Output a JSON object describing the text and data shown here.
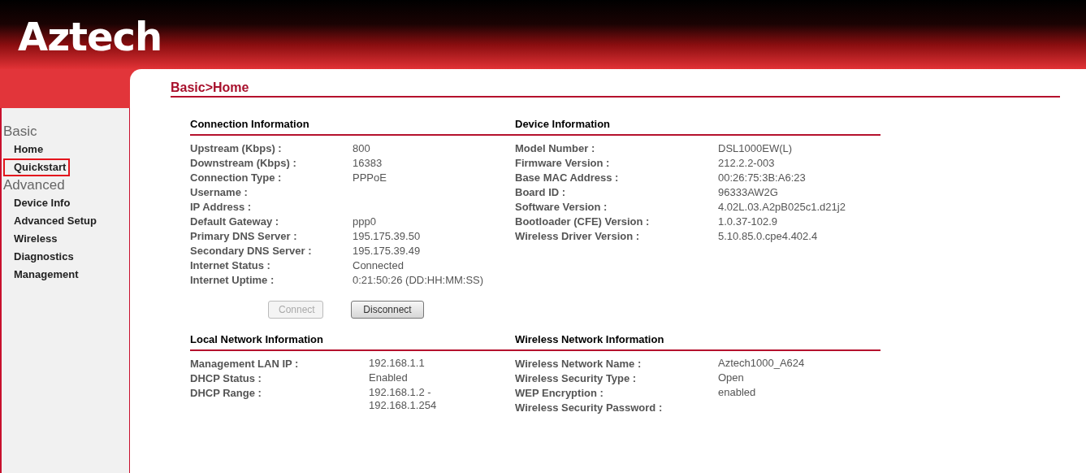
{
  "logo": "Aztech",
  "sidebar": {
    "groups": [
      {
        "title": "Basic",
        "items": [
          {
            "label": "Home",
            "highlighted": false
          },
          {
            "label": "Quickstart",
            "highlighted": true
          }
        ]
      },
      {
        "title": "Advanced",
        "items": [
          {
            "label": "Device Info",
            "highlighted": false
          },
          {
            "label": "Advanced Setup",
            "highlighted": false
          },
          {
            "label": "Wireless",
            "highlighted": false
          },
          {
            "label": "Diagnostics",
            "highlighted": false
          },
          {
            "label": "Management",
            "highlighted": false
          }
        ]
      }
    ]
  },
  "breadcrumb": "Basic>Home",
  "sections": [
    {
      "title": "Connection Information",
      "rows": [
        {
          "label": "Upstream (Kbps) :",
          "value": "800"
        },
        {
          "label": "Downstream (Kbps) :",
          "value": "16383"
        },
        {
          "label": "Connection Type :",
          "value": "PPPoE"
        },
        {
          "label": "Username :"
        },
        {
          "label": "IP Address :"
        },
        {
          "label": "Default Gateway :",
          "value": "ppp0"
        },
        {
          "label": "Primary DNS Server :",
          "value": "195.175.39.50"
        },
        {
          "label": "Secondary DNS Server :",
          "value": "195.175.39.49"
        },
        {
          "label": "Internet Status :",
          "value": "Connected"
        },
        {
          "label": "Internet Uptime :",
          "value": "0:21:50:26 (DD:HH:MM:SS)"
        }
      ]
    },
    {
      "title": "Device Information",
      "rows": [
        {
          "label": "Model Number :",
          "value": "DSL1000EW(L)"
        },
        {
          "label": "Firmware Version :",
          "value": "212.2.2-003"
        },
        {
          "label": "Base MAC Address :",
          "value": "00:26:75:3B:A6:23"
        },
        {
          "label": "Board ID :",
          "value": "96333AW2G"
        },
        {
          "label": "Software Version :",
          "value": "4.02L.03.A2pB025c1.d21j2"
        },
        {
          "label": "Bootloader (CFE) Version :",
          "value": "1.0.37-102.9"
        },
        {
          "label": "Wireless Driver Version :",
          "value": "5.10.85.0.cpe4.402.4"
        }
      ]
    },
    {
      "title": "Local Network Information",
      "rows": [
        {
          "label": "Management LAN IP :",
          "value": "192.168.1.1"
        },
        {
          "label": "DHCP Status :",
          "value": "Enabled"
        },
        {
          "label": "DHCP Range :",
          "value": "192.168.1.2 -\n192.168.1.254"
        }
      ]
    },
    {
      "title": "Wireless Network Information",
      "rows": [
        {
          "label": "Wireless Network Name :",
          "value": "Aztech1000_A624"
        },
        {
          "label": "Wireless Security Type :",
          "value": "Open"
        },
        {
          "label": "WEP Encryption :",
          "value": "enabled"
        },
        {
          "label": "Wireless Security Password :"
        }
      ]
    }
  ],
  "buttons": [
    {
      "label": "Connect",
      "disabled": true
    },
    {
      "label": "Disconnect",
      "disabled": false
    }
  ]
}
